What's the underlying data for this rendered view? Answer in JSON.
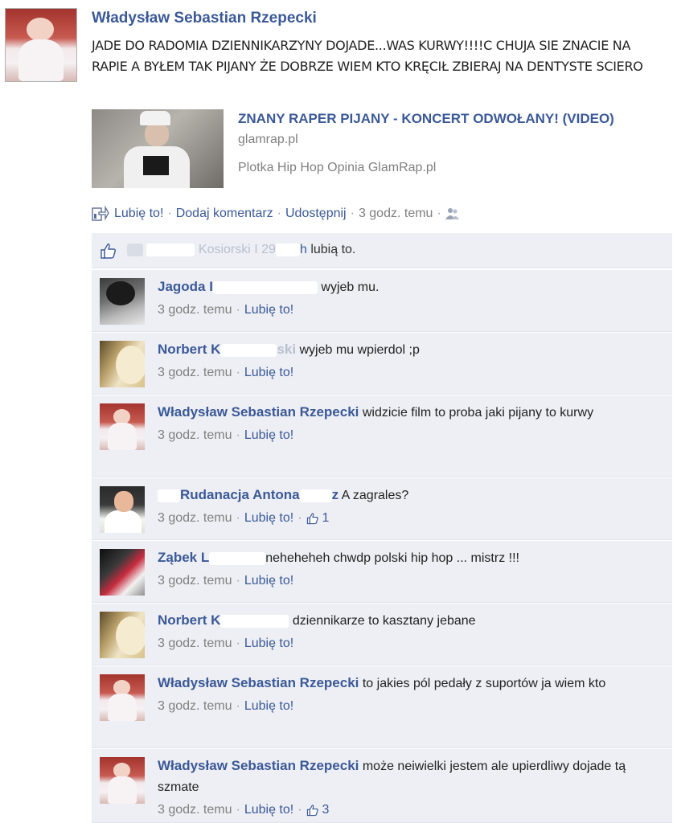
{
  "post": {
    "author": "Władysław Sebastian Rzepecki",
    "text": "JADE DO RADOMIA DZIENNIKARZYNY DOJADE...WAS KURWY!!!!C CHUJA SIE ZNACIE NA RAPIE A BYŁEM TAK PIJANY ŻE DOBRZE WIEM KTO KRĘCIŁ ZBIERAJ NA DENTYSTE SCIERO",
    "link": {
      "title": "ZNANY RAPER PIJANY - KONCERT ODWOŁANY! (VIDEO)",
      "domain": "glamrap.pl",
      "description": "Plotka Hip Hop Opinia GlamRap.pl"
    },
    "actions": {
      "like": "Lubię to!",
      "comment": "Dodaj komentarz",
      "share": "Udostępnij",
      "time": "3 godz. temu"
    }
  },
  "likes": {
    "prefix": "Kosiorski I 29",
    "suffix_link": "h",
    "suffix": "lubią to."
  },
  "separator": "·",
  "comments": [
    {
      "name_start": "Jagoda I",
      "name_end": "",
      "text": "wyjeb mu.",
      "time": "3 godz. temu",
      "like": "Lubię to!"
    },
    {
      "name_start": "Norbert K",
      "name_end": "ski",
      "text": "wyjeb mu wpierdol ;p",
      "time": "3 godz. temu",
      "like": "Lubię to!"
    },
    {
      "name_start": "Władysław Sebastian Rzepecki",
      "name_end": "",
      "text": "widzicie film to proba jaki pijany to kurwy",
      "time": "3 godz. temu",
      "like": "Lubię to!"
    },
    {
      "name_start": "Rudanacja Antona",
      "name_end": "z",
      "text": "A zagrales?",
      "time": "3 godz. temu",
      "like": "Lubię to!",
      "likes_count": "1"
    },
    {
      "name_start": "Ząbek L",
      "name_end": "",
      "text": "neheheheh chwdp polski hip hop ... mistrz !!!",
      "time": "3 godz. temu",
      "like": "Lubię to!"
    },
    {
      "name_start": "Norbert K",
      "name_end": "",
      "text": "dziennikarze to kasztany jebane",
      "time": "3 godz. temu",
      "like": "Lubię to!"
    },
    {
      "name_start": "Władysław Sebastian Rzepecki",
      "name_end": "",
      "text": "to jakies pól pedały z suportów ja wiem kto",
      "time": "3 godz. temu",
      "like": "Lubię to!"
    },
    {
      "name_start": "Władysław Sebastian Rzepecki",
      "name_end": "",
      "text": "może neiwielki jestem ale upierdliwy dojade tą szmate",
      "time": "3 godz. temu",
      "like": "Lubię to!",
      "likes_count": "3"
    }
  ],
  "colors": {
    "link": "#3b5998",
    "comment_bg": "#edeff4",
    "meta": "#808080"
  },
  "icons": [
    "like-share-icon",
    "thumbs-up-icon",
    "friends-icon"
  ]
}
